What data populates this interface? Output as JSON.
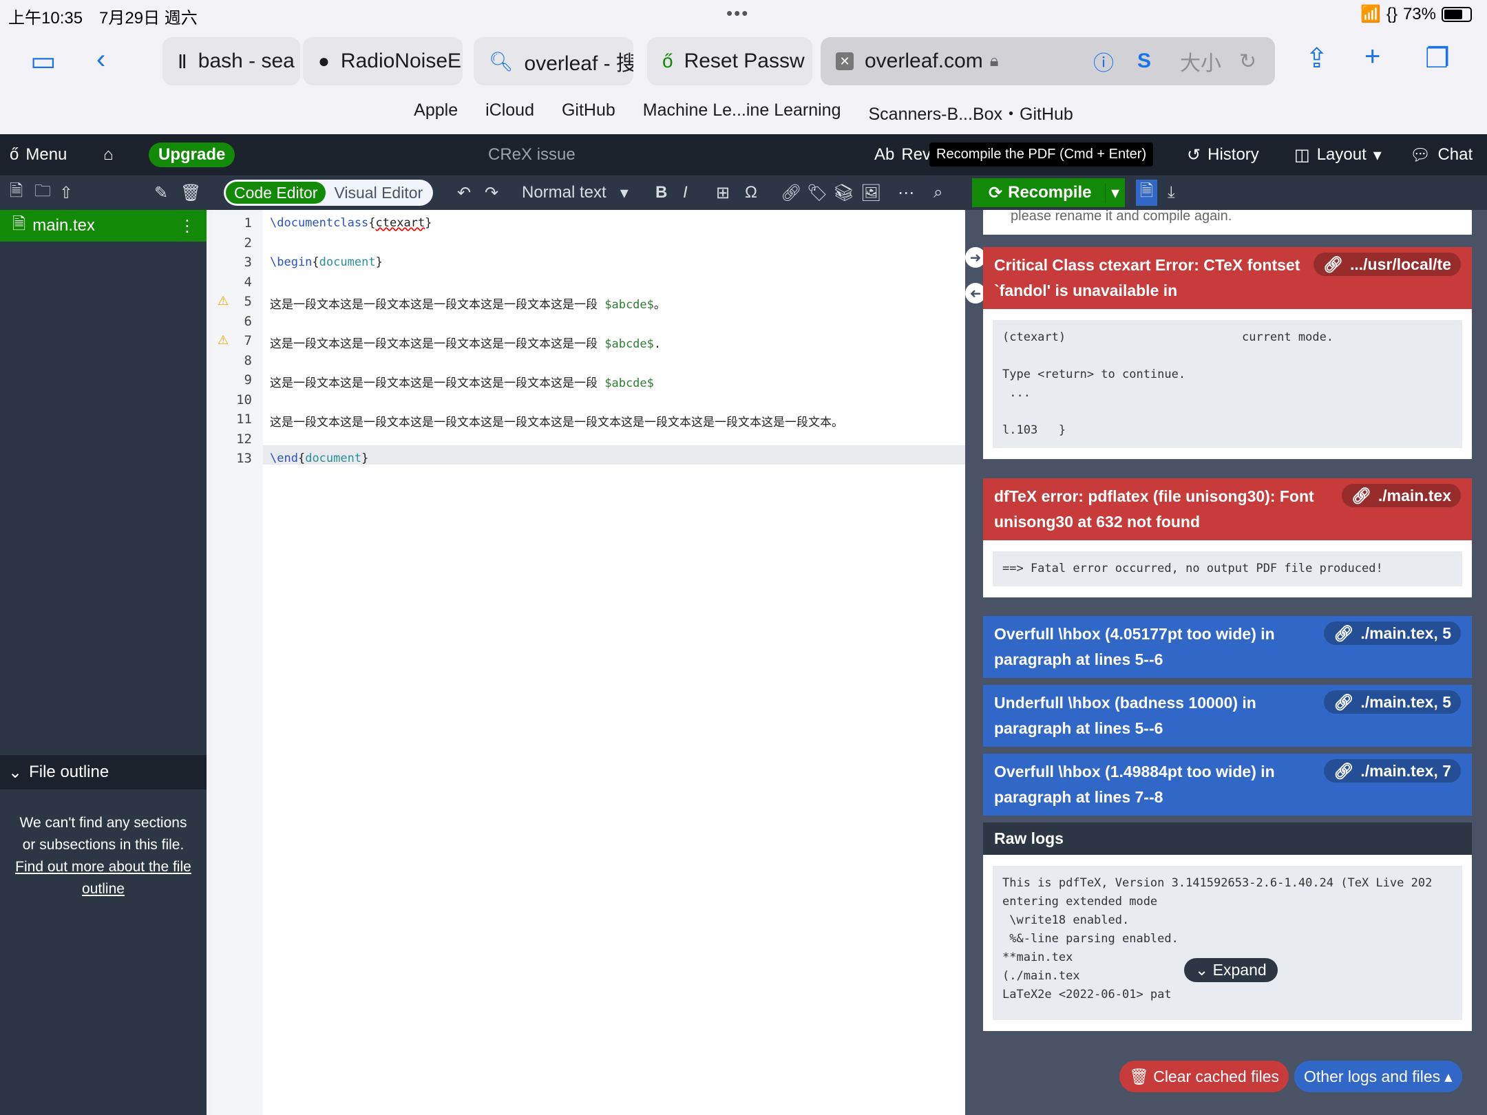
{
  "status": {
    "time": "上午10:35　7月29日 週六",
    "dots": "•••",
    "battery": "73%",
    "battery_level": 0.73
  },
  "safari": {
    "tabs": [
      "bash - sea",
      "RadioNoiseE",
      "overleaf - 搜",
      "Reset Passw",
      "overleaf.com"
    ],
    "text_size": "大小",
    "favorites": [
      "Apple",
      "iCloud",
      "GitHub",
      "Machine Le...ine Learning",
      "Scanners-B...Box・GitHub"
    ]
  },
  "overleaf": {
    "menu": "Menu",
    "upgrade": "Upgrade",
    "project": "CReX issue",
    "review": "Rev",
    "tooltip": "Recompile the PDF (Cmd + Enter)",
    "history": "History",
    "layout": "Layout",
    "chat": "Chat",
    "code_editor": "Code Editor",
    "visual_editor": "Visual Editor",
    "text_style": "Normal text",
    "recompile": "Recompile",
    "file": "main.tex",
    "outline_title": "File outline",
    "outline_msg": "We can't find any sections or subsections in this file.",
    "outline_link": "Find out more about the file outline"
  },
  "code_lines": [
    {
      "n": "1",
      "html": "<span class='kw'>\\documentclass</span>{<span style='text-decoration:underline wavy red'>ctexart</span>}"
    },
    {
      "n": "2",
      "html": ""
    },
    {
      "n": "3",
      "html": "<span class='kw'>\\begin</span>{<span class='arg'>document</span>}"
    },
    {
      "n": "4",
      "html": ""
    },
    {
      "n": "5",
      "html": "这是一段文本这是一段文本这是一段文本这是一段文本这是一段 <span class='math'>$abcde$</span>。",
      "warn": true
    },
    {
      "n": "6",
      "html": ""
    },
    {
      "n": "7",
      "html": "这是一段文本这是一段文本这是一段文本这是一段文本这是一段 <span class='math'>$abcde$</span>.",
      "warn": true
    },
    {
      "n": "8",
      "html": ""
    },
    {
      "n": "9",
      "html": "这是一段文本这是一段文本这是一段文本这是一段文本这是一段 <span class='math'>$abcde$</span>"
    },
    {
      "n": "10",
      "html": ""
    },
    {
      "n": "11",
      "html": "这是一段文本这是一段文本这是一段文本这是一段文本这是一段文本这是一段文本这是一段文本这是一段文本。"
    },
    {
      "n": "12",
      "html": ""
    },
    {
      "n": "13",
      "html": "<span class='kw'>\\end</span>{<span class='arg'>document</span>}"
    }
  ],
  "logs": {
    "rename_msg": "please rename it and compile again.",
    "err1": {
      "title": "Critical Class ctexart Error: CTeX fontset `fandol' is unavailable in",
      "link": ".../usr/local/te",
      "body": "(ctexart)                         current mode.\n\nType <return> to continue.\n ...\n\nl.103   }"
    },
    "err2": {
      "title": "dfTeX error: pdflatex (file unisong30): Font unisong30 at 632 not found",
      "link": "./main.tex",
      "body": "==> Fatal error occurred, no output PDF file produced!"
    },
    "warns": [
      {
        "title": "Overfull \\hbox (4.05177pt too wide) in paragraph at lines 5--6",
        "link": "./main.tex, 5"
      },
      {
        "title": "Underfull \\hbox (badness 10000) in paragraph at lines 5--6",
        "link": "./main.tex, 5"
      },
      {
        "title": "Overfull \\hbox (1.49884pt too wide) in paragraph at lines 7--8",
        "link": "./main.tex, 7"
      }
    ],
    "raw_title": "Raw logs",
    "raw": "This is pdfTeX, Version 3.141592653-2.6-1.40.24 (TeX Live 202\nentering extended mode\n \\write18 enabled.\n %&-line parsing enabled.\n**main.tex\n(./main.tex\nLaTeX2e <2022-06-01> pat",
    "expand": "Expand",
    "clear": "Clear cached files",
    "other": "Other logs and files"
  }
}
